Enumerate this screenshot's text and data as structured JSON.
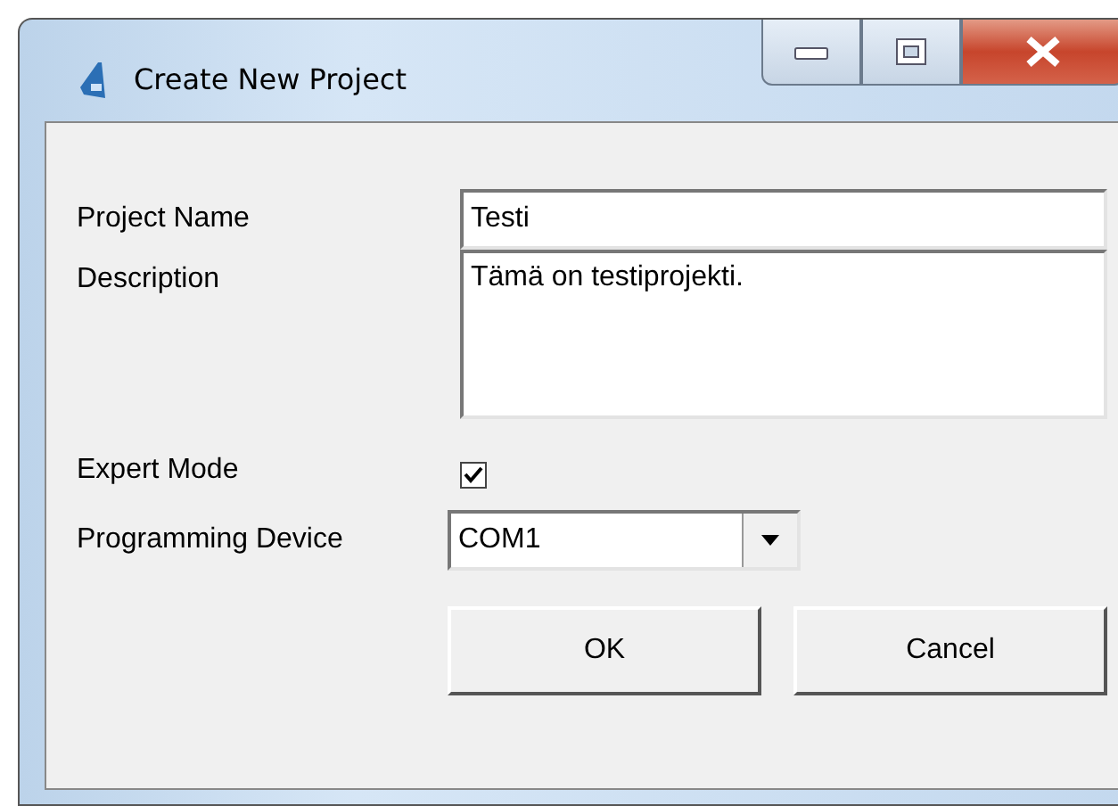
{
  "window": {
    "title": "Create New Project"
  },
  "fields": [
    {
      "kind": "text",
      "label": "Project Name",
      "value": "Testi"
    },
    {
      "kind": "textarea",
      "label": "Description",
      "value": "Tämä on testiprojekti."
    },
    {
      "kind": "checkbox",
      "label": "Expert Mode",
      "checked": true
    },
    {
      "kind": "dropdown",
      "label": "Programming Device",
      "value": "COM1"
    }
  ],
  "buttons": [
    "OK",
    "Cancel"
  ]
}
